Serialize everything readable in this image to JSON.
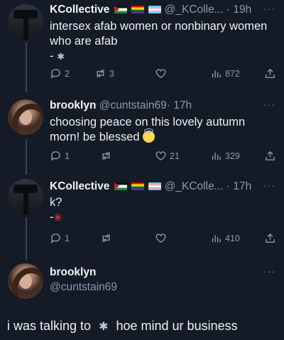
{
  "tweets": [
    {
      "name": "KCollective",
      "handle": "@_KColle...",
      "time": "· 19h",
      "more": "···",
      "text": "intersex afab women or nonbinary women who are afab",
      "line2": "-",
      "stats": {
        "replies": "2",
        "retweets": "3",
        "likes": "",
        "views": "872"
      }
    },
    {
      "name": "brooklyn",
      "handle": "@cuntstain69",
      "time": "· 17h",
      "more": "···",
      "text": "choosing peace on this lovely autumn morn! be blessed",
      "stats": {
        "replies": "1",
        "retweets": "",
        "likes": "21",
        "views": "329"
      }
    },
    {
      "name": "KCollective",
      "handle": "@_KColle...",
      "time": "· 17h",
      "more": "···",
      "text": "k?",
      "line2": "-",
      "stats": {
        "replies": "1",
        "retweets": "",
        "likes": "",
        "views": "410"
      }
    }
  ],
  "reply": {
    "name": "brooklyn",
    "handle": "@cuntstain69",
    "more": "···",
    "text_before": "i was talking to",
    "text_after": "hoe mind ur business"
  },
  "icons": [
    "reply-icon",
    "retweet-icon",
    "like-icon",
    "views-icon",
    "share-icon",
    "spider-emoji",
    "rose-emoji",
    "halo-smile-emoji"
  ],
  "colors": {
    "background": "#141b26",
    "text": "#e7e9ea",
    "muted": "#8b98a5"
  }
}
